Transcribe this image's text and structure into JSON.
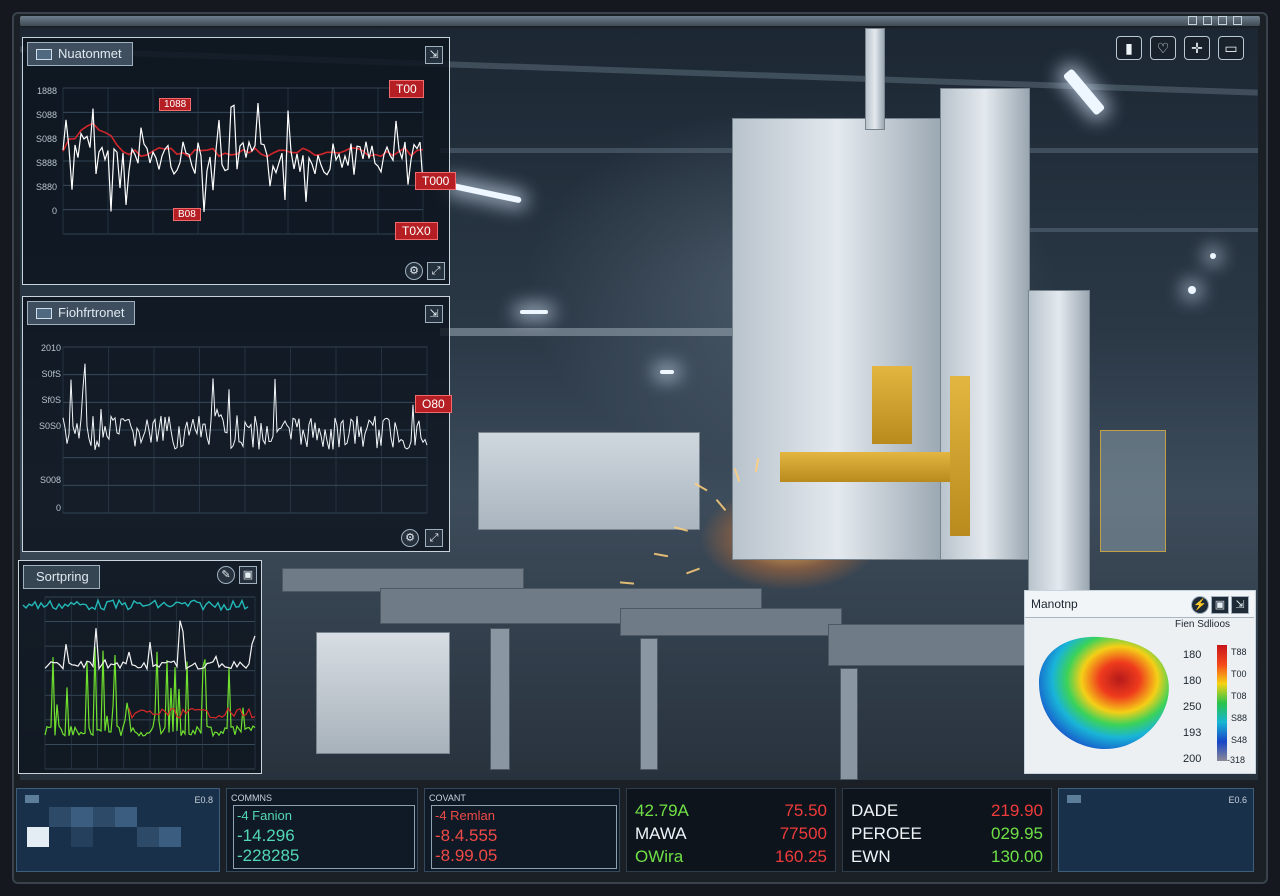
{
  "window": {
    "controls": [
      "minimize",
      "maximize",
      "restore",
      "close"
    ]
  },
  "toolbar": {
    "icons": [
      "split-view-icon",
      "heart-monitor-icon",
      "crosshair-icon",
      "window-icon"
    ]
  },
  "panel1": {
    "title": "Nuatonmet",
    "ticks": [
      "1888",
      "S088",
      "S088",
      "S888",
      "S880",
      "0"
    ],
    "tags": {
      "top_right": "T00",
      "mid_left": "1088",
      "right": "T000",
      "low": "B08",
      "bottom_right": "T0X0"
    },
    "colors": {
      "signal": "#ffffff",
      "trend": "#d2262b"
    }
  },
  "panel2": {
    "title": "Fiohfrtronet",
    "ticks": [
      "2010",
      "S0fS",
      "Sf0S",
      "S0S0",
      "S008",
      "0"
    ],
    "tags": {
      "right": "O80"
    }
  },
  "panel3": {
    "title": "Sortpring",
    "colors": {
      "teal": "#22b8b8",
      "green": "#6fe02f",
      "red": "#d72a2a",
      "white": "#f4f4f4"
    }
  },
  "panel4": {
    "title": "Manotnp",
    "subtitle": "Fien Sdlioos",
    "left_labels": [
      "180",
      "180",
      "250",
      "193",
      "200"
    ],
    "scale_labels": [
      "T88",
      "T00",
      "T08",
      "S88",
      "S48",
      "-318"
    ]
  },
  "bottom": {
    "box1": {
      "label": "E0.8"
    },
    "box2": {
      "header": "COMMNS",
      "line1": "-4 Fanion",
      "line2": "-14.296",
      "line3": "-228285"
    },
    "box3": {
      "header": "COVANT",
      "line1": "-4 Remlan",
      "line2": "-8.4.555",
      "line3": "-8.99.05"
    },
    "box4": {
      "rows": [
        {
          "name": "42.79A",
          "value": "75.50"
        },
        {
          "name": "MAWA",
          "value": "77500"
        },
        {
          "name": "OWira",
          "value": "160.25"
        }
      ]
    },
    "box5": {
      "rows": [
        {
          "name": "DADE",
          "value": "219.90"
        },
        {
          "name": "PEROEE",
          "value": "029.95"
        },
        {
          "name": "EWN",
          "value": "130.00"
        }
      ]
    },
    "box6": {
      "label": "E0.6"
    }
  }
}
